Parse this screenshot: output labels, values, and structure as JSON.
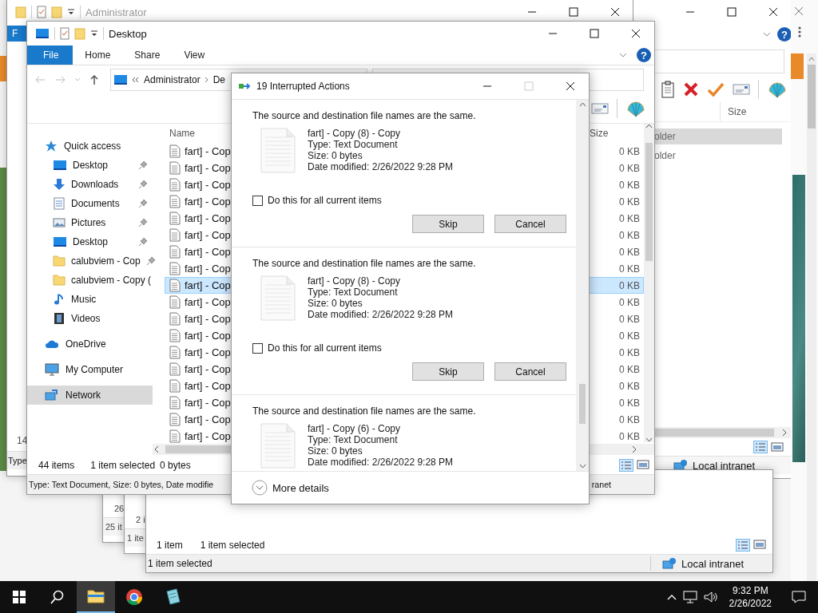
{
  "admin_window": {
    "title": "Administrator",
    "ribbon_tab": "F",
    "fragments": [
      "14",
      "Type"
    ]
  },
  "right_window": {
    "help_label": "?",
    "size_header": "Size",
    "rows": [
      {
        "name": "older",
        "selected": true
      },
      {
        "name": "older",
        "selected": false
      }
    ],
    "status_zone": "Local intranet"
  },
  "stacked_windows": [
    {
      "fragments": [
        "26",
        "25 it"
      ]
    },
    {
      "fragments": [
        "2 i",
        "1 ite"
      ]
    }
  ],
  "lower_window": {
    "item_count": "1 item",
    "selection": "1 item selected",
    "status": "1 item selected",
    "status_zone": "Local intranet"
  },
  "explorer": {
    "title": "Desktop",
    "help_label": "?",
    "ribbon_tabs": [
      {
        "label": "File",
        "selected": true
      },
      {
        "label": "Home",
        "selected": false
      },
      {
        "label": "Share",
        "selected": false
      },
      {
        "label": "View",
        "selected": false
      }
    ],
    "address": [
      "Administrator",
      "De"
    ],
    "nav": [
      {
        "label": "Quick access",
        "kind": "star",
        "selected": false,
        "children": [
          {
            "label": "Desktop",
            "kind": "desktop",
            "pinned": true,
            "selected": false
          },
          {
            "label": "Downloads",
            "kind": "downloads",
            "pinned": true,
            "selected": false
          },
          {
            "label": "Documents",
            "kind": "documents",
            "pinned": true,
            "selected": false
          },
          {
            "label": "Pictures",
            "kind": "pictures",
            "pinned": true,
            "selected": false
          },
          {
            "label": "Desktop",
            "kind": "desktop",
            "pinned": true,
            "selected": false
          },
          {
            "label": "calubviem - Cop",
            "kind": "folder",
            "pinned": true,
            "selected": false
          },
          {
            "label": "calubviem - Copy (",
            "kind": "folder",
            "pinned": false,
            "selected": false
          },
          {
            "label": "Music",
            "kind": "music",
            "pinned": false,
            "selected": false
          },
          {
            "label": "Videos",
            "kind": "videos",
            "pinned": false,
            "selected": false
          }
        ]
      },
      {
        "label": "OneDrive",
        "kind": "cloud",
        "selected": false
      },
      {
        "label": "My Computer",
        "kind": "computer",
        "selected": false
      },
      {
        "label": "Network",
        "kind": "network",
        "selected": true
      }
    ],
    "name_header": "Name",
    "size_header": "Size",
    "files": [
      {
        "name": "fart] - Cop",
        "size": "0 KB",
        "selected": false
      },
      {
        "name": "fart] - Cop",
        "size": "0 KB",
        "selected": false
      },
      {
        "name": "fart] - Cop",
        "size": "0 KB",
        "selected": false
      },
      {
        "name": "fart] - Cop",
        "size": "0 KB",
        "selected": false
      },
      {
        "name": "fart] - Cop",
        "size": "0 KB",
        "selected": false
      },
      {
        "name": "fart] - Cop",
        "size": "0 KB",
        "selected": false
      },
      {
        "name": "fart] - Cop",
        "size": "0 KB",
        "selected": false
      },
      {
        "name": "fart] - Cop",
        "size": "0 KB",
        "selected": false
      },
      {
        "name": "fart] - Cop",
        "size": "0 KB",
        "selected": true
      },
      {
        "name": "fart] - Cop",
        "size": "0 KB",
        "selected": false
      },
      {
        "name": "fart] - Cop",
        "size": "0 KB",
        "selected": false
      },
      {
        "name": "fart] - Cop",
        "size": "0 KB",
        "selected": false
      },
      {
        "name": "fart] - Cop",
        "size": "0 KB",
        "selected": false
      },
      {
        "name": "fart] - Cop",
        "size": "0 KB",
        "selected": false
      },
      {
        "name": "fart] - Cop",
        "size": "0 KB",
        "selected": false
      },
      {
        "name": "fart] - Cop",
        "size": "0 KB",
        "selected": false
      },
      {
        "name": "fart] - Cop",
        "size": "0 KB",
        "selected": false
      },
      {
        "name": "fart] - Cop",
        "size": "0 KB",
        "selected": false
      }
    ],
    "status": {
      "item_count": "44 items",
      "selection": "1 item selected",
      "selection_size": "0 bytes"
    },
    "details": "Type: Text Document, Size: 0 bytes, Date modifie",
    "details_zone": "ranet"
  },
  "dialog": {
    "title": "19 Interrupted Actions",
    "conflicts": [
      {
        "message": "The source and destination file names are the same.",
        "file_name": "fart] - Copy (8) - Copy",
        "type": "Type: Text Document",
        "size": "Size: 0 bytes",
        "modified": "Date modified: 2/26/2022 9:28 PM",
        "apply_all": {
          "label": "Do this for all current items",
          "checked": false
        },
        "buttons": [
          "Skip",
          "Cancel"
        ]
      },
      {
        "message": "The source and destination file names are the same.",
        "file_name": "fart] - Copy (8) - Copy",
        "type": "Type: Text Document",
        "size": "Size: 0 bytes",
        "modified": "Date modified: 2/26/2022 9:28 PM",
        "apply_all": {
          "label": "Do this for all current items",
          "checked": false
        },
        "buttons": [
          "Skip",
          "Cancel"
        ]
      },
      {
        "message": "The source and destination file names are the same.",
        "file_name": "fart] - Copy (6) - Copy",
        "type": "Type: Text Document",
        "size": "Size: 0 bytes",
        "modified": "Date modified: 2/26/2022 9:28 PM"
      }
    ],
    "more_details": "More details"
  },
  "taskbar": {
    "apps": [
      {
        "kind": "folder",
        "active": true
      },
      {
        "kind": "browser",
        "active": false
      },
      {
        "kind": "notes",
        "active": false
      }
    ],
    "time": "9:32 PM",
    "date": "2/26/2022"
  }
}
